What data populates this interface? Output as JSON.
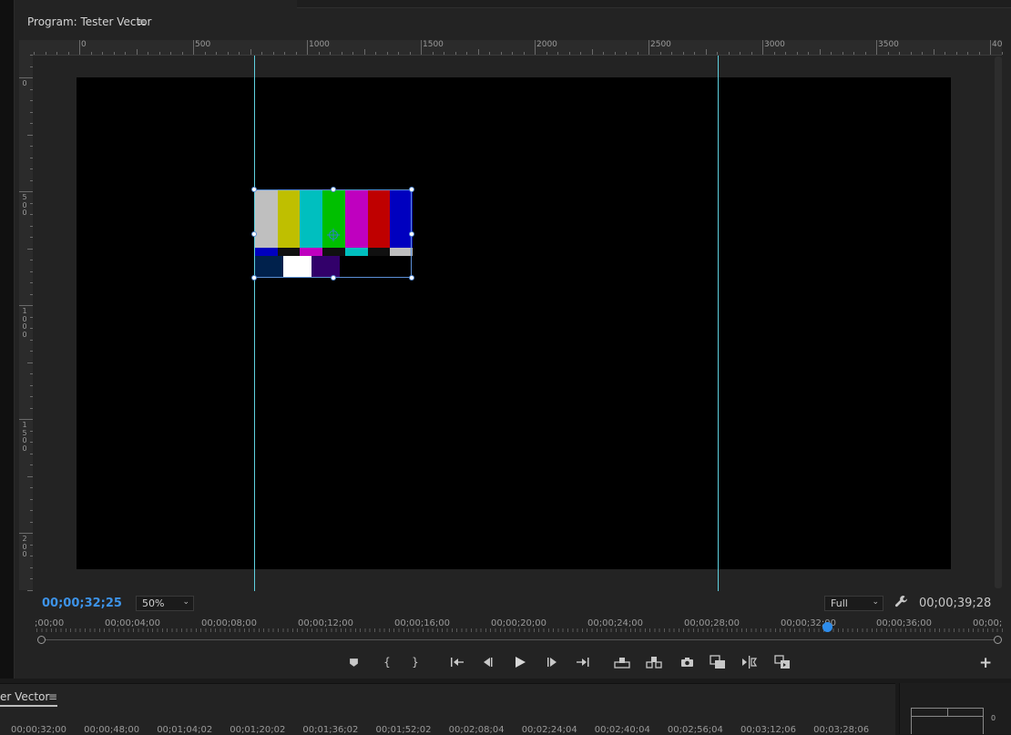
{
  "panel": {
    "title": "Program: Tester Vector",
    "menu_icon": "≡"
  },
  "ruler_top": {
    "labels": [
      "0",
      "500",
      "1000",
      "1500",
      "2000",
      "2500",
      "3000",
      "3500",
      "40"
    ]
  },
  "ruler_left": {
    "labels": [
      "0",
      "5 0 0",
      "1 0 0 0",
      "1 5 0 0",
      "2 0 0"
    ]
  },
  "viewer": {
    "test_card_bars": [
      "#bfbfbf",
      "#bfbf00",
      "#00bfbf",
      "#00bf00",
      "#bf00bf",
      "#bf0000",
      "#0000bf"
    ],
    "test_card_mid": [
      "#0000bf",
      "#101010",
      "#bf00bf",
      "#101010",
      "#00bfbf",
      "#101010",
      "#bfbfbf"
    ],
    "test_card_bottom": [
      "#00214c",
      "#ffffff",
      "#32006a",
      "#000000"
    ]
  },
  "controls": {
    "current_timecode": "00;00;32;25",
    "zoom": "50%",
    "quality": "Full",
    "duration_timecode": "00;00;39;28",
    "chevron": "⌄"
  },
  "mini_timeline": {
    "labels": [
      ";00;00",
      "00;00;04;00",
      "00;00;08;00",
      "00;00;12;00",
      "00;00;16;00",
      "00;00;20;00",
      "00;00;24;00",
      "00;00;28;00",
      "00;00;32;00",
      "00;00;36;00",
      "00;00;"
    ],
    "playhead_seconds": 32.83
  },
  "transport": {
    "marker": "⬟",
    "mark_in": "{",
    "mark_out": "}",
    "go_to_in": "⇤",
    "step_back": "◀",
    "play": "▶",
    "step_forward": "▶",
    "go_to_out": "⇥",
    "lift": "⏏",
    "extract": "⏏",
    "export_frame": "📷",
    "compare": "▣",
    "trim": "⊳",
    "multicam": "⧉",
    "add": "+"
  },
  "bottom_panel": {
    "title": "er Vector",
    "menu_icon": "≡",
    "timecodes": [
      "00;00;32;00",
      "00;00;48;00",
      "00;01;04;02",
      "00;01;20;02",
      "00;01;36;02",
      "00;01;52;02",
      "00;02;08;04",
      "00;02;24;04",
      "00;02;40;04",
      "00;02;56;04",
      "00;03;12;06",
      "00;03;28;06"
    ],
    "meter_zero": "0"
  }
}
